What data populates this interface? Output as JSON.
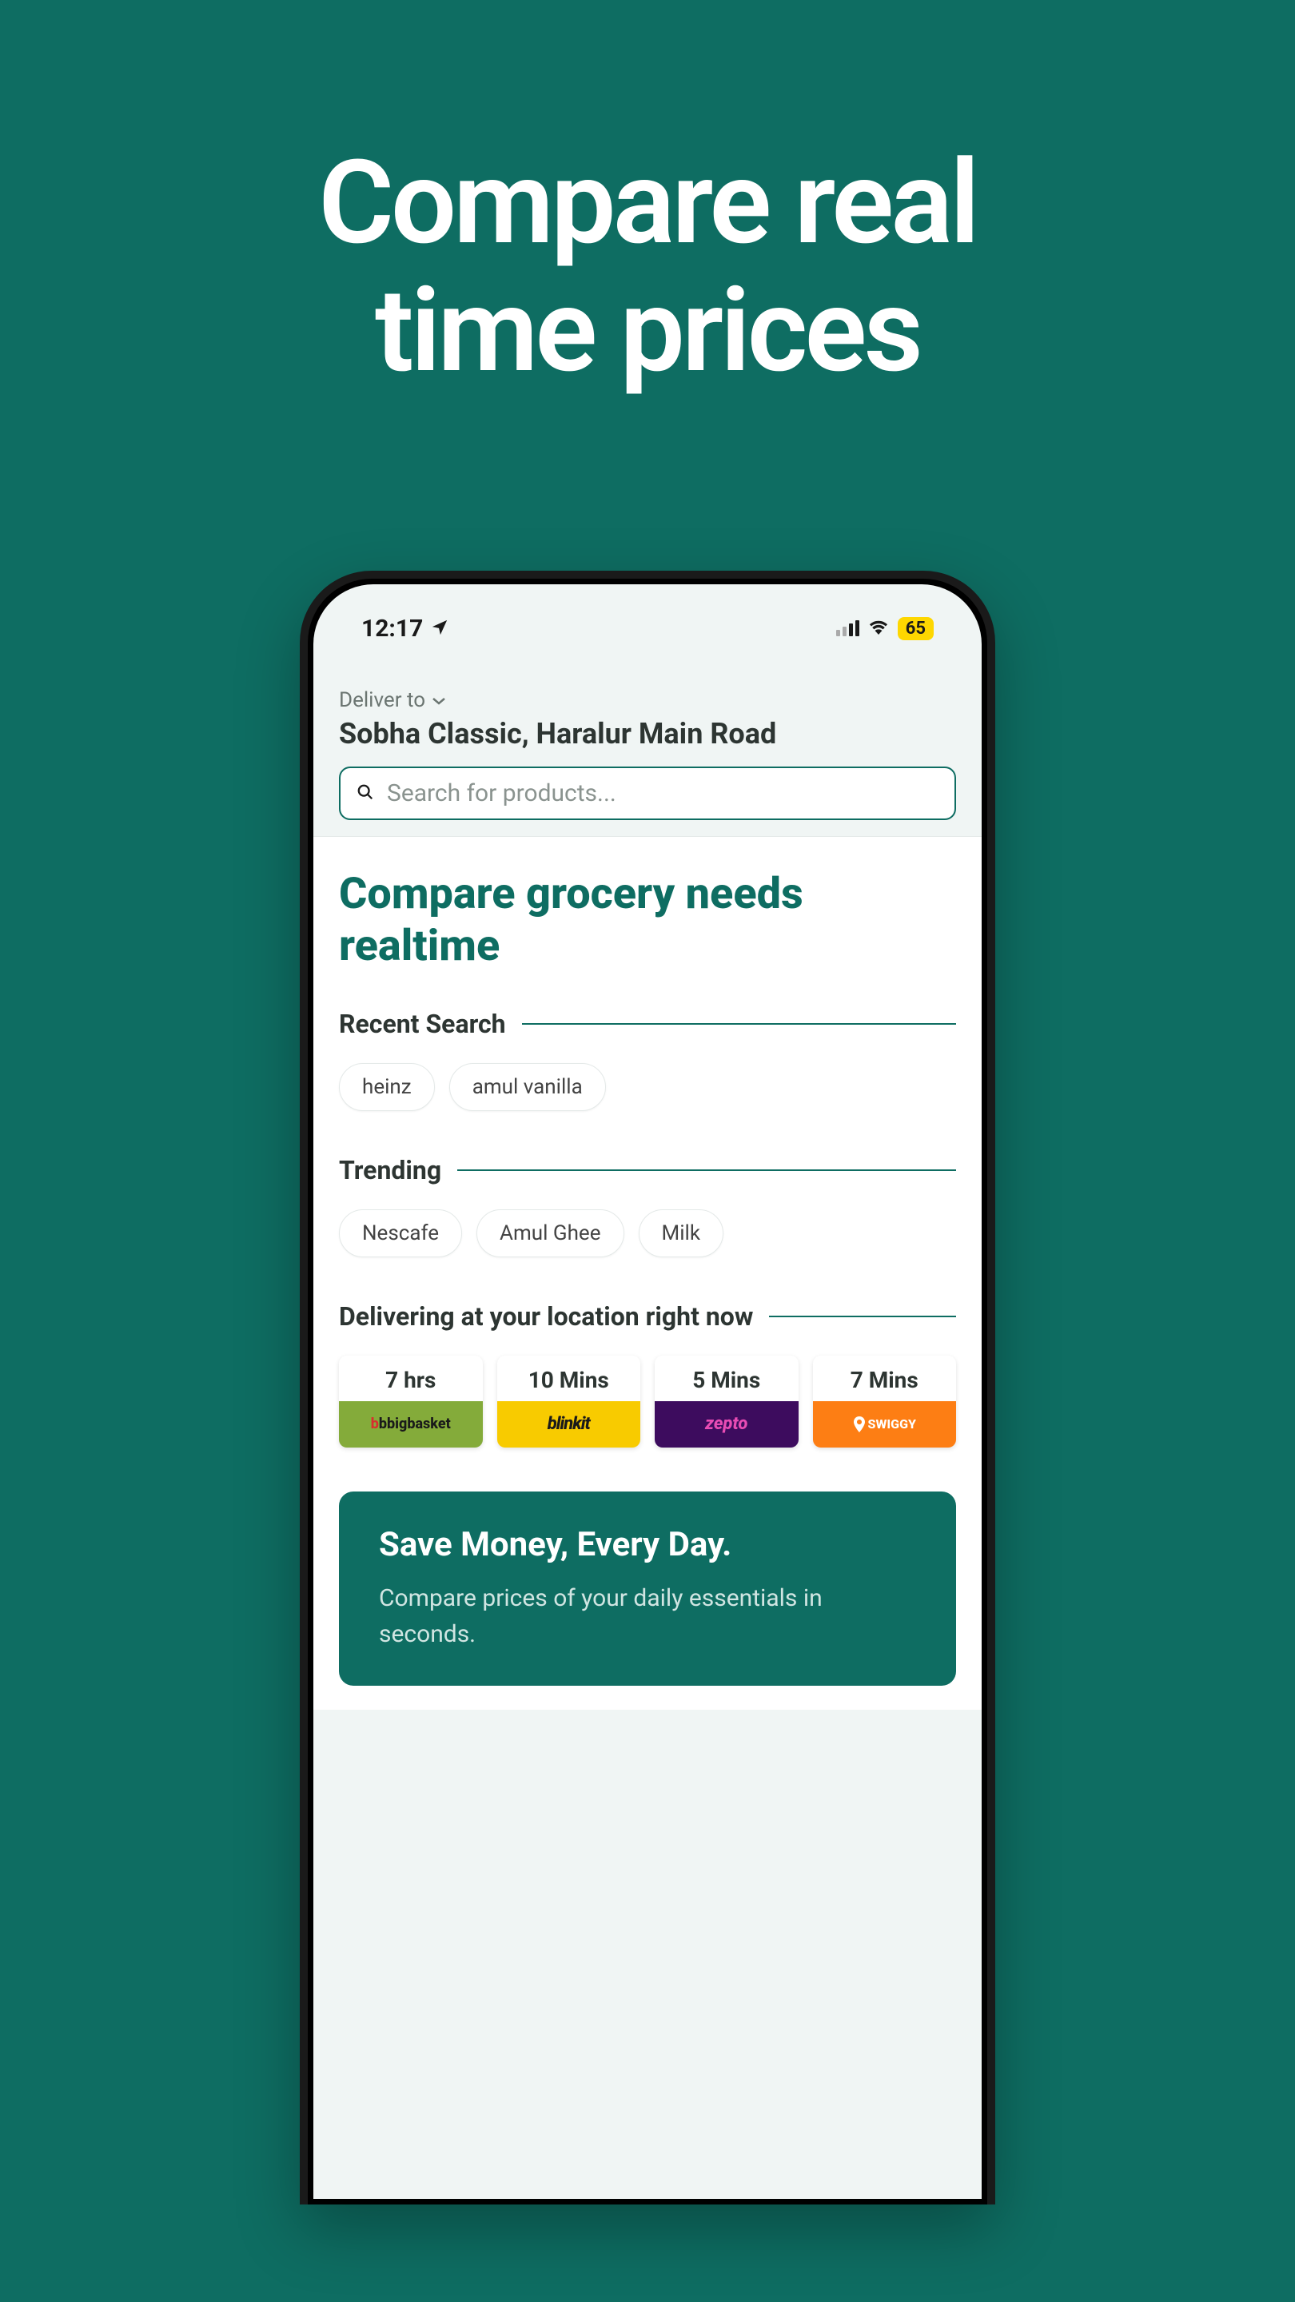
{
  "marketing": {
    "title_line1": "Compare real",
    "title_line2": "time prices"
  },
  "status_bar": {
    "time": "12:17",
    "battery": "65"
  },
  "header": {
    "deliver_to_label": "Deliver to",
    "address": "Sobha Classic, Haralur Main Road",
    "search_placeholder": "Search for products..."
  },
  "main": {
    "headline": "Compare grocery needs realtime",
    "recent_search": {
      "title": "Recent Search",
      "chips": [
        "heinz",
        "amul vanilla"
      ]
    },
    "trending": {
      "title": "Trending",
      "chips": [
        "Nescafe",
        "Amul Ghee",
        "Milk"
      ]
    },
    "delivering": {
      "title": "Delivering at your location right now",
      "providers": [
        {
          "time": "7 hrs",
          "name": "bigbasket"
        },
        {
          "time": "10 Mins",
          "name": "blinkit"
        },
        {
          "time": "5 Mins",
          "name": "zepto"
        },
        {
          "time": "7 Mins",
          "name": "SWIGGY"
        }
      ]
    },
    "promo": {
      "title": "Save Money, Every Day.",
      "text": "Compare prices of your daily essentials in seconds."
    }
  }
}
